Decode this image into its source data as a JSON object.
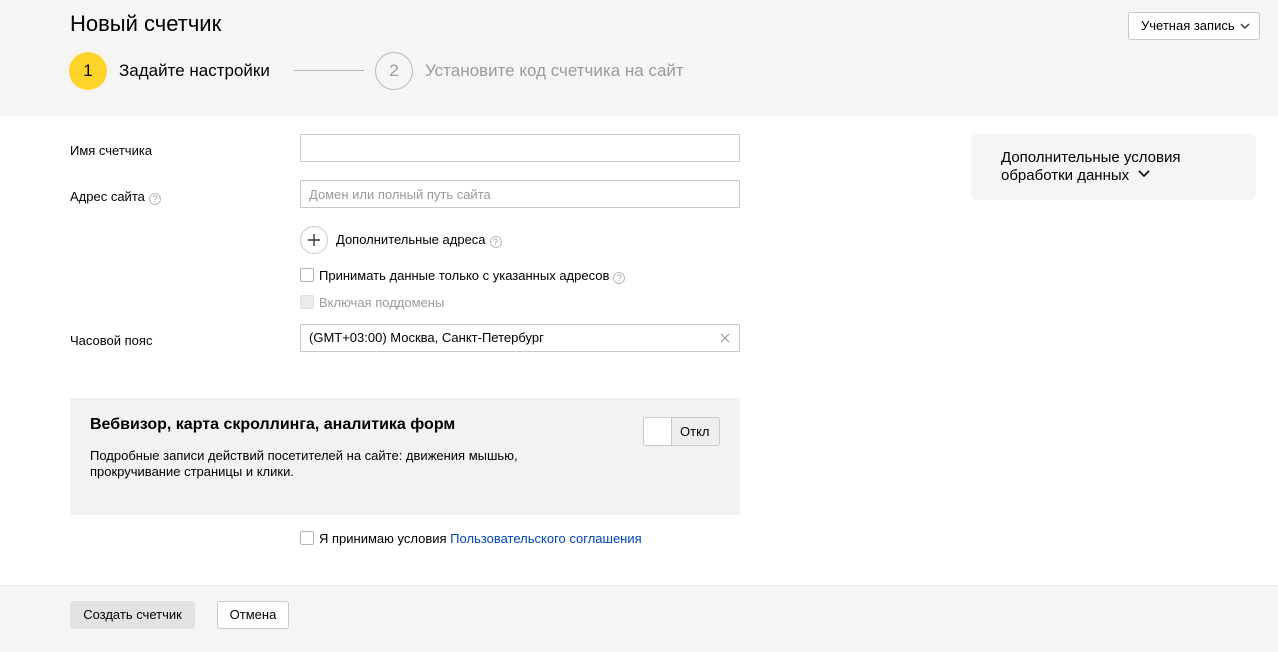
{
  "header": {
    "title": "Новый счетчик",
    "account_button": "Учетная запись",
    "steps": [
      {
        "number": "1",
        "label": "Задайте настройки",
        "active": true
      },
      {
        "number": "2",
        "label": "Установите код счетчика на сайт",
        "active": false
      }
    ]
  },
  "form": {
    "counter_name_label": "Имя счетчика",
    "counter_name_value": "",
    "site_address_label": "Адрес сайта",
    "site_address_placeholder": "Домен или полный путь сайта",
    "additional_addresses_label": "Дополнительные адреса",
    "accept_only_label": "Принимать данные только с указанных адресов",
    "include_subdomains_label": "Включая поддомены",
    "timezone_label": "Часовой пояс",
    "timezone_value": "(GMT+03:00) Москва, Санкт-Петербург"
  },
  "webvisor": {
    "title": "Вебвизор, карта скроллинга, аналитика форм",
    "description": "Подробные записи действий посетителей на сайте: движения мышью, прокручивание страницы и клики.",
    "toggle_label": "Откл"
  },
  "agreement": {
    "prefix": "Я принимаю условия",
    "link_text": "Пользовательского соглашения"
  },
  "sidebar": {
    "extra_conditions": "Дополнительные условия обработки данных"
  },
  "footer": {
    "create_button": "Создать счетчик",
    "cancel_button": "Отмена"
  },
  "colors": {
    "accent_yellow": "#fed42b",
    "link_blue": "#0044bb",
    "header_bg": "#f6f5f3",
    "panel_bg": "#f1f2f4"
  },
  "icons": {
    "help": "question-circle-icon",
    "plus": "plus-icon",
    "clear": "close-icon",
    "dropdown": "chevron-down-icon"
  }
}
